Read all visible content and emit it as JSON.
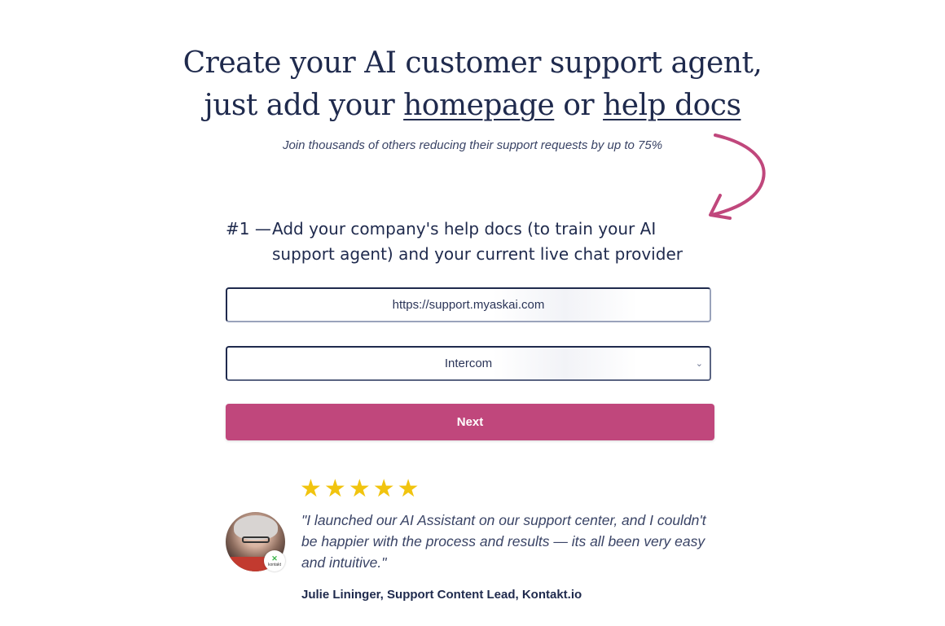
{
  "hero": {
    "line1": "Create your AI customer support agent,",
    "line2_prefix": "just add your ",
    "link_homepage": "homepage",
    "line2_middle": " or ",
    "link_help_docs": "help docs",
    "subtitle": "Join thousands of others reducing their support requests by up to 75%"
  },
  "step": {
    "number": "#1 —",
    "text": "Add your company's help docs (to train your AI support agent) and your current live chat provider"
  },
  "form": {
    "url_value": "https://support.myaskai.com",
    "chat_provider_selected": "Intercom",
    "next_label": "Next"
  },
  "testimonial": {
    "rating": 5,
    "stars": [
      "★",
      "★",
      "★",
      "★",
      "★"
    ],
    "quote": "\"I launched our AI Assistant on our support center, and I couldn't be happier with the process and results — its all been very easy and intuitive.\"",
    "author": "Julie Lininger, Support Content Lead, Kontakt.io",
    "badge_text": "kontakt"
  },
  "colors": {
    "navy": "#1f2a4d",
    "accent_pink": "#c0477c",
    "star_gold": "#f1c40f"
  }
}
